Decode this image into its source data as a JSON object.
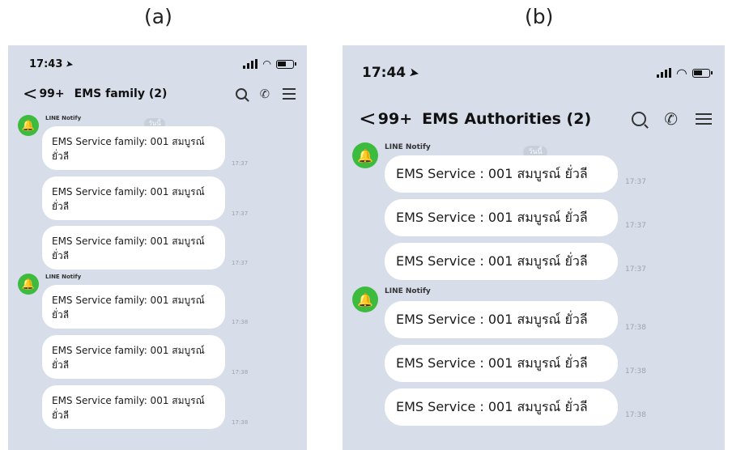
{
  "captions": {
    "a": "(a)",
    "b": "(b)"
  },
  "phone_a": {
    "time": "17:43",
    "back_arrow": "<",
    "unread_count": "99+",
    "room_title": "EMS  family (2)",
    "date_pill": "วันนี้",
    "groups": [
      {
        "sender": "LINE Notify",
        "avatar_icon": "bell-icon",
        "messages": [
          {
            "text": "EMS Service family: 001 สมบูรณ์ ยั่วลี",
            "time": "17:37"
          },
          {
            "text": "EMS Service family: 001 สมบูรณ์ ยั่วลี",
            "time": "17:37"
          },
          {
            "text": "EMS Service family: 001 สมบูรณ์ ยั่วลี",
            "time": "17:37"
          }
        ]
      },
      {
        "sender": "LINE Notify",
        "avatar_icon": "bell-icon",
        "messages": [
          {
            "text": "EMS Service family: 001 สมบูรณ์ ยั่วลี",
            "time": "17:38"
          },
          {
            "text": "EMS Service family: 001 สมบูรณ์ ยั่วลี",
            "time": "17:38"
          },
          {
            "text": "EMS Service family: 001 สมบูรณ์ ยั่วลี",
            "time": "17:38"
          }
        ]
      }
    ]
  },
  "phone_b": {
    "time": "17:44",
    "back_arrow": "<",
    "unread_count": "99+",
    "room_title": "EMS  Authorities (2)",
    "date_pill": "วันนี้",
    "groups": [
      {
        "sender": "LINE Notify",
        "avatar_icon": "bell-icon",
        "messages": [
          {
            "text": "EMS Service : 001 สมบูรณ์ ยั่วลี",
            "time": "17:37"
          },
          {
            "text": "EMS Service : 001 สมบูรณ์ ยั่วลี",
            "time": "17:37"
          },
          {
            "text": "EMS Service : 001 สมบูรณ์ ยั่วลี",
            "time": "17:37"
          }
        ]
      },
      {
        "sender": "LINE Notify",
        "avatar_icon": "bell-icon",
        "messages": [
          {
            "text": "EMS Service : 001 สมบูรณ์ ยั่วลี",
            "time": "17:38"
          },
          {
            "text": "EMS Service : 001 สมบูรณ์ ยั่วลี",
            "time": "17:38"
          },
          {
            "text": "EMS Service : 001 สมบูรณ์ ยั่วลี",
            "time": "17:38"
          }
        ]
      }
    ]
  },
  "icons": {
    "location": "location-arrow-icon",
    "signal": "signal-icon",
    "wifi": "wifi-icon",
    "battery": "battery-icon",
    "search": "search-icon",
    "call": "phone-icon",
    "menu": "menu-icon",
    "avatar": "bell-icon"
  },
  "colors": {
    "chat_background": "#d7deea",
    "bubble": "#ffffff",
    "avatar_green": "#3dbb3f",
    "timestamp": "#9aa3ae"
  }
}
